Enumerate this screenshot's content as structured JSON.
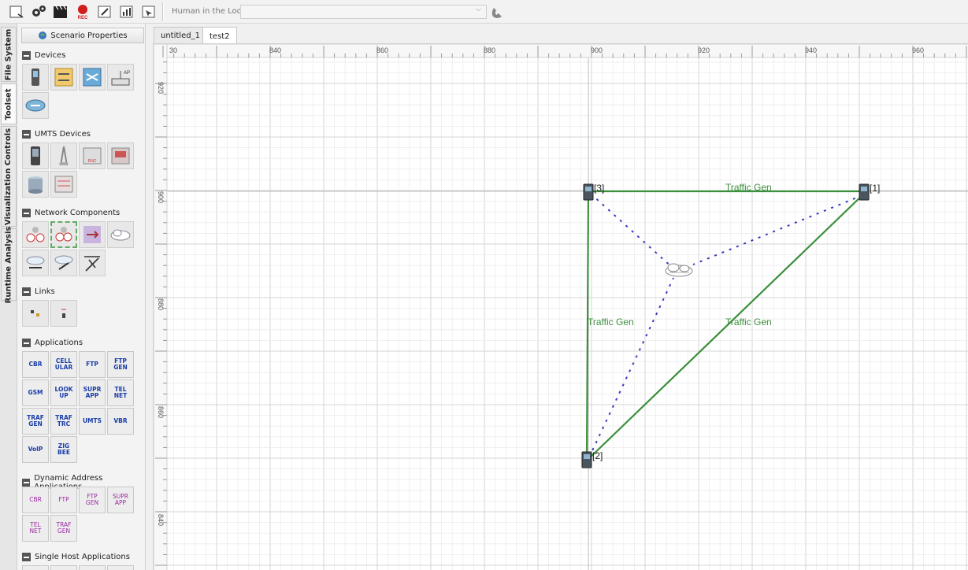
{
  "toolbar": {
    "buttons": [
      {
        "name": "new-scenario-icon",
        "glyph": "▢"
      },
      {
        "name": "settings-gears-icon",
        "glyph": "⚙"
      },
      {
        "name": "clapperboard-icon",
        "glyph": "🎬"
      },
      {
        "name": "record-icon",
        "glyph": "●",
        "label": "REC"
      },
      {
        "name": "edit-icon",
        "glyph": "✎"
      },
      {
        "name": "bar-chart-icon",
        "glyph": "▥"
      },
      {
        "name": "pointer-icon",
        "glyph": "☞"
      }
    ],
    "hitl_label": "Human in the Loop:",
    "hitl_value": ""
  },
  "vertical_tabs": [
    {
      "label": "File System",
      "active": false
    },
    {
      "label": "Toolset",
      "active": true
    },
    {
      "label": "Visualization Controls",
      "active": false
    },
    {
      "label": "Runtime Analysis",
      "active": false
    }
  ],
  "palette": {
    "scenario_properties": "Scenario Properties",
    "sections": {
      "devices": "Devices",
      "umts_devices": "UMTS Devices",
      "network_components": "Network Components",
      "links": "Links",
      "applications": "Applications",
      "dynamic_address_applications": "Dynamic Address Applications",
      "single_host_applications": "Single Host Applications"
    },
    "applications": [
      "CBR",
      "CELL\nULAR",
      "FTP",
      "FTP\nGEN",
      "GSM",
      "LOOK\nUP",
      "SUPR\nAPP",
      "TEL\nNET",
      "TRAF\nGEN",
      "TRAF\nTRC",
      "UMTS",
      "VBR",
      "VoIP",
      "ZIG\nBEE"
    ],
    "dynamic_applications": [
      "CBR",
      "FTP",
      "FTP\nGEN",
      "SUPR\nAPP",
      "TEL\nNET",
      "TRAF\nGEN"
    ]
  },
  "document_tabs": [
    {
      "label": "untitled_1",
      "active": false
    },
    {
      "label": "test2",
      "active": true
    }
  ],
  "canvas": {
    "ruler_top": [
      "30",
      "840",
      "860",
      "880",
      "900",
      "920",
      "940",
      "960"
    ],
    "ruler_left": [
      "920",
      "900",
      "880",
      "860",
      "840"
    ],
    "nodes": [
      {
        "id": "node-3",
        "label": "[3]"
      },
      {
        "id": "node-1",
        "label": "[1]"
      },
      {
        "id": "node-2",
        "label": "[2]"
      }
    ],
    "links": [
      {
        "label": "Traffic Gen"
      },
      {
        "label": "Traffic Gen"
      },
      {
        "label": "Traffic Gen"
      }
    ],
    "colors": {
      "link": "#3c8f3c",
      "wireless": "#3a3ac0",
      "grid_minor": "#ececec",
      "grid_major": "#d4d4d4"
    }
  }
}
